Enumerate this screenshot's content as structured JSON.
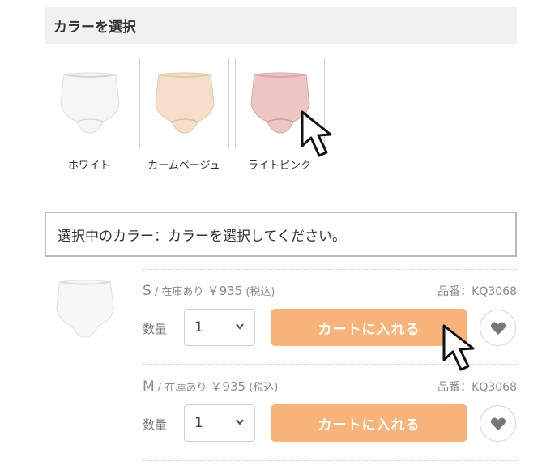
{
  "section_title": "カラーを選択",
  "colors": [
    {
      "label": "ホワイト",
      "fill": "#f6f6f6",
      "shade": "#e2e2e2"
    },
    {
      "label": "カームベージュ",
      "fill": "#f5dfca",
      "shade": "#e6c8ad"
    },
    {
      "label": "ライトピンク",
      "fill": "#ecc5c4",
      "shade": "#d9a7a7"
    }
  ],
  "selected_color_text": "選択中のカラー：カラーを選択してください。",
  "variants": [
    {
      "size": "S",
      "stock": " / 在庫あり ",
      "price": "￥935",
      "tax": " (税込)",
      "sku": "品番：KQ3068",
      "qty_label": "数量",
      "qty": "1",
      "cart_label": "カートに入れる"
    },
    {
      "size": "M",
      "stock": " / 在庫あり ",
      "price": "￥935",
      "tax": " (税込)",
      "sku": "品番：KQ3068",
      "qty_label": "数量",
      "qty": "1",
      "cart_label": "カートに入れる"
    }
  ],
  "icons": {
    "favorite": "heart-icon",
    "qty_dropdown": "chevron-down-icon",
    "pointer": "cursor-arrow-icon",
    "hand": "cursor-hand-icon"
  },
  "accent_color": "#f8b37b"
}
